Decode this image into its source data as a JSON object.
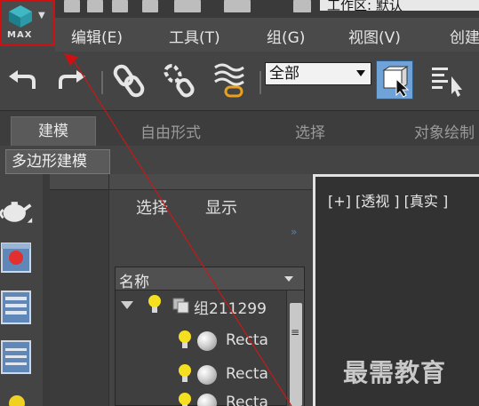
{
  "app": {
    "max_button_label": "MAX",
    "workspace_label": "工作区: 默认"
  },
  "menu": {
    "items": [
      {
        "label": "编辑(E)"
      },
      {
        "label": "工具(T)"
      },
      {
        "label": "组(G)"
      },
      {
        "label": "视图(V)"
      },
      {
        "label": "创建"
      }
    ]
  },
  "toolbar": {
    "selection_filter_value": "全部"
  },
  "ribbon": {
    "tabs": [
      {
        "label": "建模"
      },
      {
        "label": "自由形式"
      },
      {
        "label": "选择"
      },
      {
        "label": "对象绘制"
      }
    ],
    "sub_tab": "多边形建模"
  },
  "scene_explorer": {
    "tabs": [
      {
        "label": "选择"
      },
      {
        "label": "显示"
      }
    ],
    "column_header": "名称",
    "rows": [
      {
        "label": "组211299"
      },
      {
        "label": "Recta"
      },
      {
        "label": "Recta"
      },
      {
        "label": "Recta"
      }
    ]
  },
  "viewport": {
    "label": "[+] [透视 ] [真实 ]"
  },
  "watermark": {
    "text": "最需教育"
  },
  "colors": {
    "highlight_red": "#d01010",
    "active_blue": "#6fa3d8",
    "viewport_border": "#e2e2e2"
  }
}
